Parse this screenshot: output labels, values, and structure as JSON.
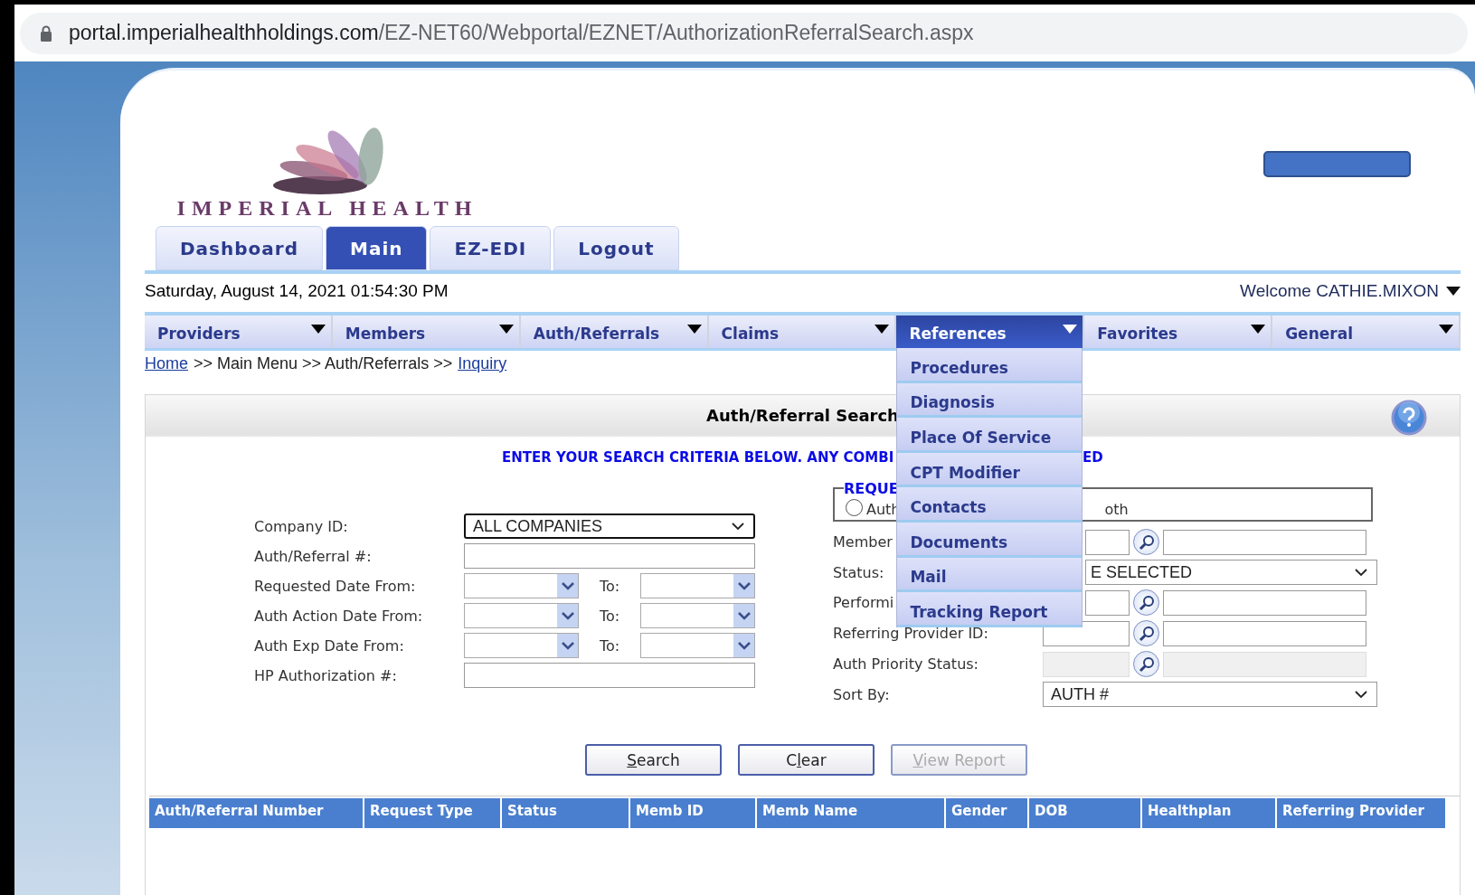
{
  "browser": {
    "url_host": "portal.imperialhealthholdings.com",
    "url_path": "/EZ-NET60/Webportal/EZNET/AuthorizationReferralSearch.aspx"
  },
  "logo": {
    "text": "IMPERIAL HEALTH"
  },
  "top_tabs": [
    {
      "label": "Dashboard",
      "selected": false
    },
    {
      "label": "Main",
      "selected": true
    },
    {
      "label": "EZ-EDI",
      "selected": false
    },
    {
      "label": "Logout",
      "selected": false
    }
  ],
  "datetime": "Saturday, August 14, 2021 01:54:30 PM",
  "welcome": "Welcome CATHIE.MIXON",
  "menu": [
    {
      "label": "Providers",
      "selected": false,
      "expanded": false
    },
    {
      "label": "Members",
      "selected": false,
      "expanded": false
    },
    {
      "label": "Auth/Referrals",
      "selected": false,
      "expanded": false
    },
    {
      "label": "Claims",
      "selected": false,
      "expanded": false
    },
    {
      "label": "References",
      "selected": true,
      "expanded": true
    },
    {
      "label": "Favorites",
      "selected": false,
      "expanded": false
    },
    {
      "label": "General",
      "selected": false,
      "expanded": false
    }
  ],
  "dropdown": [
    "Procedures",
    "Diagnosis",
    "Place Of Service",
    "CPT Modifier",
    "Contacts",
    "Documents",
    "Mail",
    "Tracking Report"
  ],
  "breadcrumb": [
    {
      "kind": "link",
      "text": "Home"
    },
    {
      "kind": "text",
      "text": ">> Main Menu >> Auth/Referrals >>"
    },
    {
      "kind": "link",
      "text": "Inquiry"
    }
  ],
  "panel": {
    "title": "Auth/Referral Search",
    "instruction_parts": [
      "ENTER YOUR SEARCH CRITERIA BELOW. ANY COMBI",
      "ED"
    ]
  },
  "left_form": [
    {
      "label": "Company ID:",
      "kind": "select",
      "value": "ALL COMPANIES"
    },
    {
      "label": "Auth/Referral #:",
      "kind": "text"
    },
    {
      "label": "Requested Date From:",
      "kind": "daterange",
      "to_label": "To:"
    },
    {
      "label": "Auth Action Date From:",
      "kind": "daterange",
      "to_label": "To:"
    },
    {
      "label": "Auth Exp Date From:",
      "kind": "daterange",
      "to_label": "To:"
    },
    {
      "label": "HP Authorization #:",
      "kind": "text"
    }
  ],
  "request_group": {
    "legend": "REQUE",
    "radio_label": "Auth",
    "radio_selected": false,
    "trailing_text": "oth"
  },
  "right_form": [
    {
      "label": "Member",
      "kind": "lookup",
      "disabled": false
    },
    {
      "label": "Status:",
      "kind": "select",
      "value": "E SELECTED"
    },
    {
      "label": "Performi",
      "kind": "lookup",
      "disabled": false
    },
    {
      "label": "Referring Provider ID:",
      "kind": "lookup",
      "disabled": false
    },
    {
      "label": "Auth Priority Status:",
      "kind": "lookup",
      "disabled": true
    },
    {
      "label": "Sort By:",
      "kind": "select",
      "value": "AUTH #"
    }
  ],
  "buttons": [
    {
      "access_key": "S",
      "label_after": "earch",
      "disabled": false
    },
    {
      "label_before": "C",
      "access_key": "l",
      "label_after": "ear",
      "disabled": false
    },
    {
      "access_key": "V",
      "label_after": "iew Report",
      "disabled": true
    }
  ],
  "table": {
    "columns": [
      "Auth/Referral Number",
      "Request Type",
      "Status",
      "Memb ID",
      "Memb Name",
      "Gender",
      "DOB",
      "Healthplan",
      "Referring Provider"
    ]
  }
}
